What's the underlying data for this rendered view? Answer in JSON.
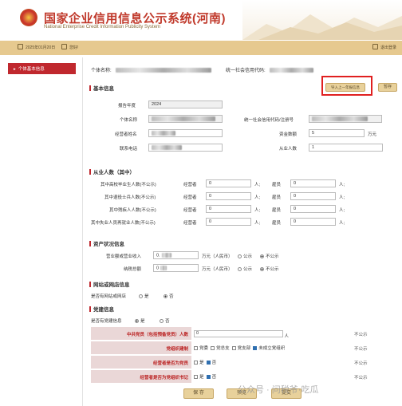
{
  "header": {
    "title_cn": "国家企业信用信息公示系统(河南)",
    "title_en": "National Enterprise Credit Information Publicity System"
  },
  "statusbar": {
    "date": "2025年01月20日",
    "user_label": "您好!",
    "logout": "退出登录"
  },
  "sidebar": {
    "items": [
      {
        "label": "个体基本信息"
      }
    ]
  },
  "entity": {
    "name_label": "个体名称:",
    "code_label": "统一社会信用代码:"
  },
  "buttons": {
    "prev_year": "导入上一年报信息",
    "save_top": "暂存",
    "save": "保 存",
    "preview": "预览",
    "submit": "提交"
  },
  "basic": {
    "section": "基本信息",
    "year_label": "报告年度",
    "year_value": "2024",
    "name_label": "个体名称",
    "code_label": "统一社会信用代码/注册号",
    "operator_label": "经营者姓名",
    "capital_label": "资金数额",
    "capital_value": "5",
    "capital_unit": "万元",
    "phone_label": "联系电话",
    "staff_label": "从业人数",
    "staff_value": "1"
  },
  "employment": {
    "section": "从业人数（其中）",
    "col_operator": "经营者",
    "col_employee": "雇员",
    "unit": "人;",
    "rows": [
      {
        "label": "其中高校毕业生人数(不公示)",
        "op": "0",
        "emp": "0"
      },
      {
        "label": "其中退役士兵人数(不公示)",
        "op": "0",
        "emp": "0"
      },
      {
        "label": "其中残疾人人数(不公示)",
        "op": "0",
        "emp": "0"
      },
      {
        "label": "其中失业人员再就业人数(不公示)",
        "op": "0",
        "emp": "0"
      }
    ]
  },
  "assets": {
    "section": "资产状况信息",
    "revenue_label": "营业额或营业收入",
    "revenue_value": "0.",
    "tax_label": "纳税总额",
    "tax_value": "0",
    "unit": "万元（人民币）",
    "public": "公示",
    "not_public": "不公示"
  },
  "website": {
    "section": "网站或网店信息",
    "question": "是否有网站或网店",
    "yes": "是",
    "no": "否"
  },
  "party": {
    "section": "党建信息",
    "question": "是否有党建信息",
    "yes": "是",
    "no": "否",
    "members_label": "中共党员（包括预备党员）人数",
    "members_value": "0",
    "members_unit": "人",
    "members_pub": "不公示",
    "org_label": "党组织建制",
    "org_options": [
      "党委",
      "党总支",
      "党支部",
      "未成立党组织"
    ],
    "org_pub": "不公示",
    "op_member_label": "经营者是否为党员",
    "op_member_yes": "是",
    "op_member_no": "否",
    "op_member_pub": "不公示",
    "op_secretary_label": "经营者是否为党组织书记",
    "op_secretary_yes": "是",
    "op_secretary_no": "否",
    "op_secretary_pub": "不公示"
  },
  "watermark": "公众号 · 问税爷·吃瓜"
}
